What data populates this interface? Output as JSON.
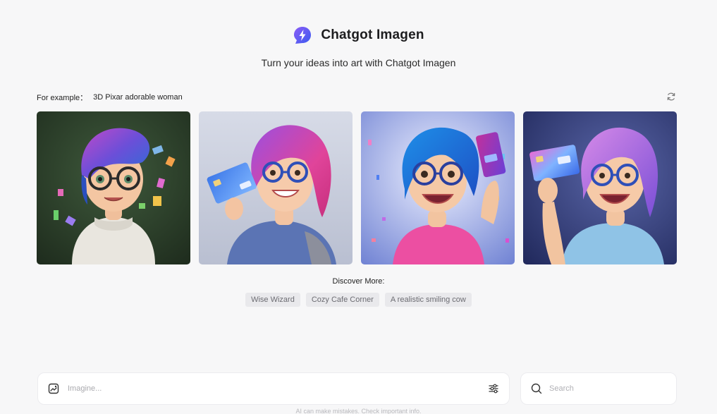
{
  "header": {
    "title": "Chatgot Imagen",
    "logo_icon": "lightning-chat-logo-icon",
    "subtitle": "Turn your ideas into art with Chatgot Imagen"
  },
  "example": {
    "label": "For example：",
    "value": "3D Pixar adorable woman",
    "refresh_icon": "refresh-icon"
  },
  "gallery": {
    "images": [
      {
        "icon": "pixar-woman-green-sweater-image"
      },
      {
        "icon": "pixar-woman-holding-blue-card-image"
      },
      {
        "icon": "pixar-woman-blue-hair-pink-card-image"
      },
      {
        "icon": "pixar-woman-purple-hair-card-image"
      }
    ]
  },
  "discover": {
    "label": "Discover More:",
    "chips": [
      "Wise Wizard",
      "Cozy Cafe Corner",
      "A realistic smiling cow"
    ]
  },
  "prompt": {
    "placeholder": "Imagine...",
    "value": "",
    "left_icon": "image-edit-icon",
    "settings_icon": "sliders-icon"
  },
  "search": {
    "placeholder": "Search",
    "icon": "search-icon"
  },
  "footer": {
    "disclaimer": "AI can make mistakes. Check important info."
  },
  "colors": {
    "background": "#f7f7f8",
    "logo_primary": "#6a4cf5",
    "chip_bg": "#e9e9ec",
    "chip_text": "#6c6c72"
  }
}
